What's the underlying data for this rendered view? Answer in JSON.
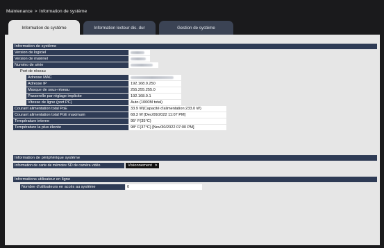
{
  "breadcrumb": {
    "root": "Maintenance",
    "sep": ">",
    "current": "Information de système"
  },
  "tabs": [
    {
      "label": "Information de système",
      "active": true
    },
    {
      "label": "Information lecteur dis. dur",
      "active": false
    },
    {
      "label": "Gestion de système",
      "active": false
    }
  ],
  "system": {
    "title": "Information de système",
    "software_label": "Version de logiciel",
    "hardware_label": "Version de matériel",
    "serial_label": "Numéro de série",
    "network_port_label": "Port de réseau",
    "mac_label": "Adresse MAC",
    "ip_label": "Adresse IP",
    "ip_value": "192.168.0.250",
    "mask_label": "Masque de sous-réseau",
    "mask_value": "255.255.255.0",
    "gateway_label": "Passerelle par réglage implicite",
    "gateway_value": "192.168.0.1",
    "speed_label": "Vitesse de ligne (port PC)",
    "speed_value": "Auto (1000M total)",
    "poe_label": "Courant alimentation total PoE",
    "poe_value": "33.9 W(Capacité d'alimentation:233.0 W)",
    "poe_max_label": "Courant alimentation total PoE maximum",
    "poe_max_value": "68.3 W [Dec/09/2022 11:07 PM]",
    "temp_label": "Température interne",
    "temp_value": "95° F(35°C)",
    "temp_max_label": "Température la plus élevée",
    "temp_max_value": "98° F(37°C) [Nov/30/2022 07:00 PM]"
  },
  "peripheral": {
    "title": "Information de périphérique système",
    "sd_label": "Information de carte de mémoire SD de caméra vidéo",
    "view_button": "Visionnement",
    "view_chevron": ">"
  },
  "users": {
    "title": "Informations utilisateur en ligne",
    "count_label": "Nombre d'utilisateurs en accès au système",
    "count_value": "0"
  }
}
